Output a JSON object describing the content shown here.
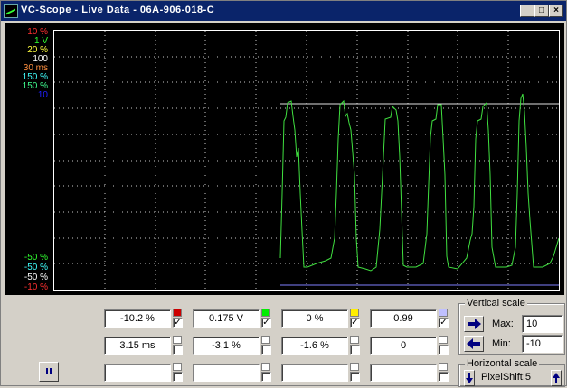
{
  "window": {
    "title": "VC-Scope  -  Live Data  -  06A-906-018-C"
  },
  "title_buttons": {
    "minimize": "_",
    "maximize": "□",
    "close": "×"
  },
  "scale_labels": {
    "top": [
      {
        "text": "10 %",
        "color": "#ff3030"
      },
      {
        "text": "1 V",
        "color": "#30ff30"
      },
      {
        "text": "20 %",
        "color": "#ffff40"
      },
      {
        "text": "100",
        "color": "#ffffff"
      },
      {
        "text": "30 ms",
        "color": "#ff9040"
      },
      {
        "text": "150 %",
        "color": "#40ffff"
      },
      {
        "text": "150 %",
        "color": "#40ff90"
      },
      {
        "text": "10",
        "color": "#2020ff"
      }
    ],
    "bottom": [
      {
        "text": "-50 %",
        "color": "#30ff30"
      },
      {
        "text": "-50 %",
        "color": "#40ffff"
      },
      {
        "text": "-50 %",
        "color": "#ffffff"
      },
      {
        "text": "-10 %",
        "color": "#ff3030"
      }
    ]
  },
  "channels_row1": [
    {
      "value": "-10.2 %",
      "color": "#cc0000",
      "checked": "✓"
    },
    {
      "value": "0.175 V",
      "color": "#00ee00",
      "checked": "✓"
    },
    {
      "value": "0 %",
      "color": "#ffee00",
      "checked": "✓"
    },
    {
      "value": "0.99",
      "color": "#c0c0ff",
      "checked": "✓"
    }
  ],
  "channels_row2": [
    {
      "value": "3.15 ms"
    },
    {
      "value": "-3.1 %"
    },
    {
      "value": "-1.6 %"
    },
    {
      "value": "0"
    }
  ],
  "pause_icon": "pause-icon",
  "vertical_scale": {
    "title": "Vertical scale",
    "max_label": "Max:",
    "max_value": "10",
    "min_label": "Min:",
    "min_value": "-10"
  },
  "horizontal_scale": {
    "title": "Horizontal scale",
    "pixelshift": "PixelShift:5"
  },
  "colors": {
    "trace": "#40e040",
    "trace_top": "#c0ffc0",
    "trace_bottom": "#8080ff"
  }
}
